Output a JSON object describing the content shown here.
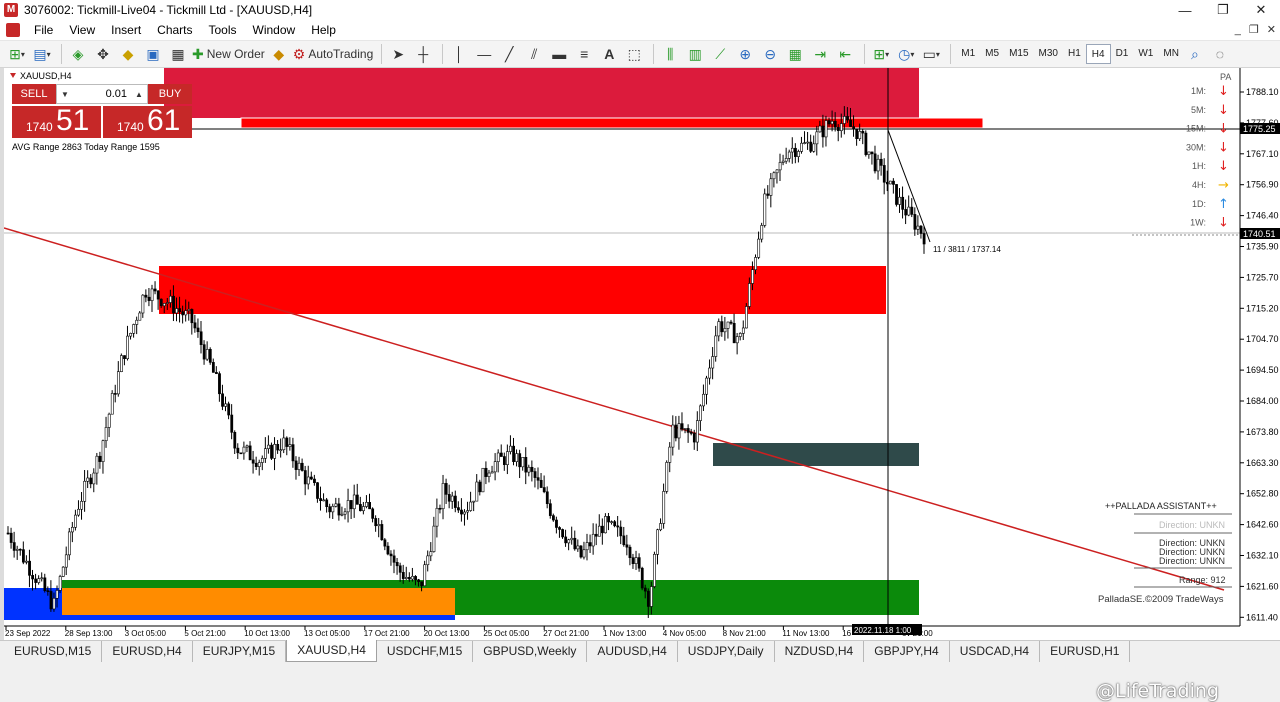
{
  "window": {
    "title": "3076002: Tickmill-Live04 - Tickmill Ltd - [XAUUSD,H4]",
    "min": "—",
    "max": "❐",
    "close": "✕"
  },
  "menu": {
    "items": [
      "File",
      "View",
      "Insert",
      "Charts",
      "Tools",
      "Window",
      "Help"
    ],
    "mdi": [
      "_",
      "❐",
      "✕"
    ]
  },
  "toolbar": {
    "new_order": "New Order",
    "autotrading": "AutoTrading",
    "timeframes": [
      "M1",
      "M5",
      "M15",
      "M30",
      "H1",
      "H4",
      "D1",
      "W1",
      "MN"
    ],
    "active_timeframe": "H4"
  },
  "chart": {
    "symbol": "XAUUSD,H4",
    "pa_label": "PA",
    "oneclick": {
      "sell": "SELL",
      "buy": "BUY",
      "lots": "0.01",
      "sell_small": "1740",
      "sell_big": "51",
      "buy_small": "1740",
      "buy_big": "61",
      "range_text": "AVG Range 2863    Today Range 1595"
    },
    "price_axis": [
      "1788.10",
      "1777.60",
      "1767.10",
      "1756.90",
      "1746.40",
      "1735.90",
      "1725.70",
      "1715.20",
      "1704.70",
      "1694.50",
      "1684.00",
      "1673.80",
      "1663.30",
      "1652.80",
      "1642.60",
      "1632.10",
      "1621.60",
      "1611.40"
    ],
    "price_marker_1": "1775.25",
    "price_marker_2": "1740.51",
    "time_axis": [
      "23 Sep 2022",
      "28 Sep 13:00",
      "3 Oct 05:00",
      "5 Oct 21:00",
      "10 Oct 13:00",
      "13 Oct 05:00",
      "17 Oct 21:00",
      "20 Oct 13:00",
      "25 Oct 05:00",
      "27 Oct 21:00",
      "1 Nov 13:00",
      "4 Nov 05:00",
      "8 Nov 21:00",
      "11 Nov 13:00",
      "16",
      "ov 21:00"
    ],
    "crosshair_time": "2022.11.18 1:00",
    "crosshair_label": "11 / 3811 / 1737.14",
    "mtf_panel": [
      {
        "tf": "1M:",
        "dir": "down",
        "color": "#e02020"
      },
      {
        "tf": "5M:",
        "dir": "down",
        "color": "#e02020"
      },
      {
        "tf": "15M:",
        "dir": "down",
        "color": "#e02020"
      },
      {
        "tf": "30M:",
        "dir": "down",
        "color": "#e02020"
      },
      {
        "tf": "1H:",
        "dir": "down",
        "color": "#e02020"
      },
      {
        "tf": "4H:",
        "dir": "right",
        "color": "#f0b400"
      },
      {
        "tf": "1D:",
        "dir": "up",
        "color": "#2a8ae0"
      },
      {
        "tf": "1W:",
        "dir": "down",
        "color": "#e02020"
      }
    ],
    "assistant": {
      "title": "++PALLADA ASSISTANT++",
      "dir_line": "Direction: UNKN",
      "dirs": [
        "Direction: UNKN",
        "Direction: UNKN",
        "Direction: UNKN"
      ],
      "range": "Range: 912",
      "copyright": "PalladaSE.©2009 TradeWays"
    }
  },
  "tabs": [
    "EURUSD,M15",
    "EURUSD,H4",
    "EURJPY,M15",
    "XAUUSD,H4",
    "USDCHF,M15",
    "GBPUSD,Weekly",
    "AUDUSD,H4",
    "USDJPY,Daily",
    "NZDUSD,H4",
    "GBPJPY,H4",
    "USDCAD,H4",
    "EURUSD,H1"
  ],
  "active_tab": "XAUUSD,H4",
  "watermark": "@LifeTrading",
  "colors": {
    "zone_red": "#ff0000",
    "zone_crimson": "#dc1b3c",
    "zone_green": "#0b8a0b",
    "zone_orange": "#ff8c00",
    "zone_blue": "#0033ff",
    "zone_dark": "#2f4a4a",
    "trendline": "#cc2020"
  },
  "chart_data": {
    "type": "candlestick",
    "symbol": "XAUUSD",
    "timeframe": "H4",
    "ylim": [
      1611.4,
      1793.0
    ],
    "close_path": [
      {
        "x": "2022-09-23",
        "y": 1642
      },
      {
        "x": "2022-09-26",
        "y": 1630
      },
      {
        "x": "2022-09-28",
        "y": 1618
      },
      {
        "x": "2022-09-29",
        "y": 1650
      },
      {
        "x": "2022-09-30",
        "y": 1668
      },
      {
        "x": "2022-10-03",
        "y": 1700
      },
      {
        "x": "2022-10-04",
        "y": 1722
      },
      {
        "x": "2022-10-05",
        "y": 1718
      },
      {
        "x": "2022-10-06",
        "y": 1712
      },
      {
        "x": "2022-10-07",
        "y": 1694
      },
      {
        "x": "2022-10-10",
        "y": 1670
      },
      {
        "x": "2022-10-11",
        "y": 1666
      },
      {
        "x": "2022-10-12",
        "y": 1672
      },
      {
        "x": "2022-10-13",
        "y": 1660
      },
      {
        "x": "2022-10-14",
        "y": 1650
      },
      {
        "x": "2022-10-17",
        "y": 1652
      },
      {
        "x": "2022-10-18",
        "y": 1648
      },
      {
        "x": "2022-10-19",
        "y": 1630
      },
      {
        "x": "2022-10-20",
        "y": 1624
      },
      {
        "x": "2022-10-21",
        "y": 1656
      },
      {
        "x": "2022-10-24",
        "y": 1650
      },
      {
        "x": "2022-10-25",
        "y": 1664
      },
      {
        "x": "2022-10-26",
        "y": 1668
      },
      {
        "x": "2022-10-27",
        "y": 1660
      },
      {
        "x": "2022-10-28",
        "y": 1645
      },
      {
        "x": "2022-10-31",
        "y": 1634
      },
      {
        "x": "2022-11-01",
        "y": 1645
      },
      {
        "x": "2022-11-02",
        "y": 1640
      },
      {
        "x": "2022-11-03",
        "y": 1620
      },
      {
        "x": "2022-11-04",
        "y": 1676
      },
      {
        "x": "2022-11-07",
        "y": 1674
      },
      {
        "x": "2022-11-08",
        "y": 1711
      },
      {
        "x": "2022-11-09",
        "y": 1706
      },
      {
        "x": "2022-11-10",
        "y": 1750
      },
      {
        "x": "2022-11-11",
        "y": 1768
      },
      {
        "x": "2022-11-14",
        "y": 1770
      },
      {
        "x": "2022-11-15",
        "y": 1778
      },
      {
        "x": "2022-11-16",
        "y": 1775
      },
      {
        "x": "2022-11-17",
        "y": 1762
      },
      {
        "x": "2022-11-18",
        "y": 1750
      },
      {
        "x": "2022-11-21",
        "y": 1740
      }
    ]
  }
}
